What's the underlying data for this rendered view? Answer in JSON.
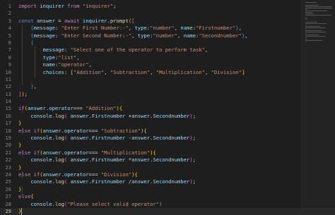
{
  "editor": {
    "lines": [
      {
        "num": "1",
        "tokens": [
          [
            "kw",
            "import"
          ],
          [
            "pun",
            " "
          ],
          [
            "var",
            "inquirer"
          ],
          [
            "pun",
            " "
          ],
          [
            "kw",
            "from"
          ],
          [
            "pun",
            " "
          ],
          [
            "str",
            "\"inquirer\""
          ],
          [
            "pun",
            ";"
          ]
        ]
      },
      {
        "num": "2",
        "tokens": []
      },
      {
        "num": "3",
        "tokens": [
          [
            "kw2",
            "const"
          ],
          [
            "pun",
            " "
          ],
          [
            "var",
            "answer"
          ],
          [
            "pun",
            " = "
          ],
          [
            "kw",
            "await"
          ],
          [
            "pun",
            " "
          ],
          [
            "var",
            "inquirer"
          ],
          [
            "pun",
            "."
          ],
          [
            "fn",
            "prompt"
          ],
          [
            "br1",
            "("
          ],
          [
            "br2",
            "["
          ]
        ]
      },
      {
        "num": "4",
        "tokens": [
          [
            "pun",
            "    "
          ],
          [
            "br3",
            "{"
          ],
          [
            "var",
            "message"
          ],
          [
            "pun",
            ": "
          ],
          [
            "str",
            "\"Enter First Number:-\""
          ],
          [
            "pun",
            ", "
          ],
          [
            "var",
            "type"
          ],
          [
            "pun",
            ":"
          ],
          [
            "str",
            "\"number\""
          ],
          [
            "pun",
            ", "
          ],
          [
            "var",
            "name"
          ],
          [
            "pun",
            ":"
          ],
          [
            "str",
            "\"Firstnumber\""
          ],
          [
            "br3",
            "}"
          ],
          [
            "pun",
            ","
          ]
        ]
      },
      {
        "num": "5",
        "tokens": [
          [
            "pun",
            "    "
          ],
          [
            "br3",
            "{"
          ],
          [
            "var",
            "message"
          ],
          [
            "pun",
            ": "
          ],
          [
            "str",
            "\"Enter Second Number:-\""
          ],
          [
            "pun",
            ", "
          ],
          [
            "var",
            "type"
          ],
          [
            "pun",
            ":"
          ],
          [
            "str",
            "\"number\""
          ],
          [
            "pun",
            ", "
          ],
          [
            "var",
            "name"
          ],
          [
            "pun",
            ":"
          ],
          [
            "str",
            "\"Secondnumber\""
          ],
          [
            "br3",
            "}"
          ],
          [
            "pun",
            ","
          ]
        ]
      },
      {
        "num": "6",
        "tokens": [
          [
            "pun",
            "    "
          ],
          [
            "br3",
            "{"
          ]
        ]
      },
      {
        "num": "7",
        "tokens": [
          [
            "pun",
            "        "
          ],
          [
            "var",
            "message"
          ],
          [
            "pun",
            ": "
          ],
          [
            "str",
            "\"Select one of the operator to perform task\""
          ],
          [
            "pun",
            ","
          ]
        ]
      },
      {
        "num": "8",
        "tokens": [
          [
            "pun",
            "        "
          ],
          [
            "var",
            "type"
          ],
          [
            "pun",
            ":"
          ],
          [
            "str",
            "\"list\""
          ],
          [
            "pun",
            ","
          ]
        ]
      },
      {
        "num": "9",
        "tokens": [
          [
            "pun",
            "        "
          ],
          [
            "var",
            "name"
          ],
          [
            "pun",
            ":"
          ],
          [
            "str",
            "\"operator\""
          ],
          [
            "pun",
            ","
          ]
        ]
      },
      {
        "num": "10",
        "tokens": [
          [
            "pun",
            "        "
          ],
          [
            "var",
            "choices"
          ],
          [
            "pun",
            ": "
          ],
          [
            "br1",
            "["
          ],
          [
            "str",
            "\"Addition\""
          ],
          [
            "pun",
            ", "
          ],
          [
            "str",
            "\"Subtraction\""
          ],
          [
            "pun",
            ", "
          ],
          [
            "str",
            "\"Multiplication\""
          ],
          [
            "pun",
            ", "
          ],
          [
            "str",
            "\"Division\""
          ],
          [
            "br1",
            "]"
          ]
        ]
      },
      {
        "num": "11",
        "tokens": []
      },
      {
        "num": "12",
        "tokens": [
          [
            "pun",
            "    "
          ],
          [
            "br3",
            "}"
          ],
          [
            "pun",
            ","
          ]
        ]
      },
      {
        "num": "13",
        "tokens": [
          [
            "br2",
            "]"
          ],
          [
            "br1",
            ")"
          ],
          [
            "pun",
            ";"
          ]
        ]
      },
      {
        "num": "14",
        "tokens": []
      },
      {
        "num": "15",
        "tokens": [
          [
            "kw",
            "if"
          ],
          [
            "br1",
            "("
          ],
          [
            "var",
            "answer"
          ],
          [
            "pun",
            "."
          ],
          [
            "var",
            "operator"
          ],
          [
            "pun",
            "=== "
          ],
          [
            "str",
            "\"Addition\""
          ],
          [
            "br1",
            ")"
          ],
          [
            "br1",
            "{"
          ]
        ]
      },
      {
        "num": "16",
        "tokens": [
          [
            "pun",
            "    "
          ],
          [
            "var",
            "console"
          ],
          [
            "pun",
            "."
          ],
          [
            "fn",
            "log"
          ],
          [
            "br2",
            "("
          ],
          [
            "pun",
            " "
          ],
          [
            "var",
            "answer"
          ],
          [
            "pun",
            "."
          ],
          [
            "var",
            "Firstnumber"
          ],
          [
            "pun",
            " +"
          ],
          [
            "var",
            "answer"
          ],
          [
            "pun",
            "."
          ],
          [
            "var",
            "Secondnumber"
          ],
          [
            "br2",
            ")"
          ],
          [
            "pun",
            ";"
          ]
        ]
      },
      {
        "num": "17",
        "tokens": [
          [
            "br1",
            "}"
          ]
        ]
      },
      {
        "num": "18",
        "tokens": [
          [
            "kw",
            "else"
          ],
          [
            "pun",
            " "
          ],
          [
            "kw",
            "if"
          ],
          [
            "br1",
            "("
          ],
          [
            "var",
            "answer"
          ],
          [
            "pun",
            "."
          ],
          [
            "var",
            "operator"
          ],
          [
            "pun",
            "=== "
          ],
          [
            "str",
            "\"Subtraction\""
          ],
          [
            "br1",
            ")"
          ],
          [
            "br1",
            "{"
          ]
        ]
      },
      {
        "num": "19",
        "tokens": [
          [
            "pun",
            "    "
          ],
          [
            "var",
            "console"
          ],
          [
            "pun",
            "."
          ],
          [
            "fn",
            "log"
          ],
          [
            "br2",
            "("
          ],
          [
            "pun",
            " "
          ],
          [
            "var",
            "answer"
          ],
          [
            "pun",
            "."
          ],
          [
            "var",
            "Firstnumber"
          ],
          [
            "pun",
            " -"
          ],
          [
            "var",
            "answer"
          ],
          [
            "pun",
            "."
          ],
          [
            "var",
            "Secondnumber"
          ],
          [
            "br2",
            ")"
          ],
          [
            "pun",
            ";"
          ]
        ]
      },
      {
        "num": "20",
        "tokens": [
          [
            "br1",
            "}"
          ]
        ]
      },
      {
        "num": "21",
        "tokens": [
          [
            "kw",
            "else"
          ],
          [
            "pun",
            " "
          ],
          [
            "kw",
            "if"
          ],
          [
            "br1",
            "("
          ],
          [
            "var",
            "answer"
          ],
          [
            "pun",
            "."
          ],
          [
            "var",
            "operator"
          ],
          [
            "pun",
            "=== "
          ],
          [
            "str",
            "\"Multiplication\""
          ],
          [
            "br1",
            ")"
          ],
          [
            "br1",
            "{"
          ]
        ]
      },
      {
        "num": "22",
        "tokens": [
          [
            "pun",
            "    "
          ],
          [
            "var",
            "console"
          ],
          [
            "pun",
            "."
          ],
          [
            "fn",
            "log"
          ],
          [
            "br2",
            "("
          ],
          [
            "pun",
            " "
          ],
          [
            "var",
            "answer"
          ],
          [
            "pun",
            "."
          ],
          [
            "var",
            "Firstnumber"
          ],
          [
            "pun",
            " *"
          ],
          [
            "var",
            "answer"
          ],
          [
            "pun",
            "."
          ],
          [
            "var",
            "Secondnumber"
          ],
          [
            "br2",
            ")"
          ],
          [
            "pun",
            ";"
          ]
        ]
      },
      {
        "num": "23",
        "tokens": [
          [
            "br1",
            "}"
          ]
        ]
      },
      {
        "num": "24",
        "tokens": [
          [
            "kw",
            "else"
          ],
          [
            "pun",
            " "
          ],
          [
            "kw",
            "if"
          ],
          [
            "br1",
            "("
          ],
          [
            "var",
            "answer"
          ],
          [
            "pun",
            "."
          ],
          [
            "var",
            "operator"
          ],
          [
            "pun",
            "=== "
          ],
          [
            "str",
            "\"Division\""
          ],
          [
            "br1",
            ")"
          ],
          [
            "br1",
            "{"
          ]
        ]
      },
      {
        "num": "25",
        "tokens": [
          [
            "pun",
            "    "
          ],
          [
            "var",
            "console"
          ],
          [
            "pun",
            "."
          ],
          [
            "fn",
            "log"
          ],
          [
            "br2",
            "("
          ],
          [
            "pun",
            " "
          ],
          [
            "var",
            "answer"
          ],
          [
            "pun",
            "."
          ],
          [
            "var",
            "Firstnumber"
          ],
          [
            "pun",
            " /"
          ],
          [
            "var",
            "answer"
          ],
          [
            "pun",
            "."
          ],
          [
            "var",
            "Secondnumber"
          ],
          [
            "br2",
            ")"
          ],
          [
            "pun",
            ";"
          ]
        ]
      },
      {
        "num": "26",
        "tokens": [
          [
            "br1",
            "}"
          ]
        ]
      },
      {
        "num": "27",
        "tokens": [
          [
            "kw",
            "else"
          ],
          [
            "br1",
            "{"
          ]
        ]
      },
      {
        "num": "28",
        "tokens": [
          [
            "pun",
            "    "
          ],
          [
            "var",
            "console"
          ],
          [
            "pun",
            "."
          ],
          [
            "fn",
            "log"
          ],
          [
            "br2",
            "("
          ],
          [
            "str",
            "\"Please select valid operator\""
          ],
          [
            "br2",
            ")"
          ]
        ]
      },
      {
        "num": "29",
        "tokens": [
          [
            "br1",
            "}"
          ]
        ]
      }
    ],
    "active_line": "29",
    "colors": {
      "background": "#1e1e1e",
      "keyword": "#c586c0",
      "declaration": "#569cd6",
      "variable": "#9cdcfe",
      "function": "#dcdcaa",
      "string": "#ce9178"
    }
  },
  "minimap": {
    "label": "minimap"
  }
}
